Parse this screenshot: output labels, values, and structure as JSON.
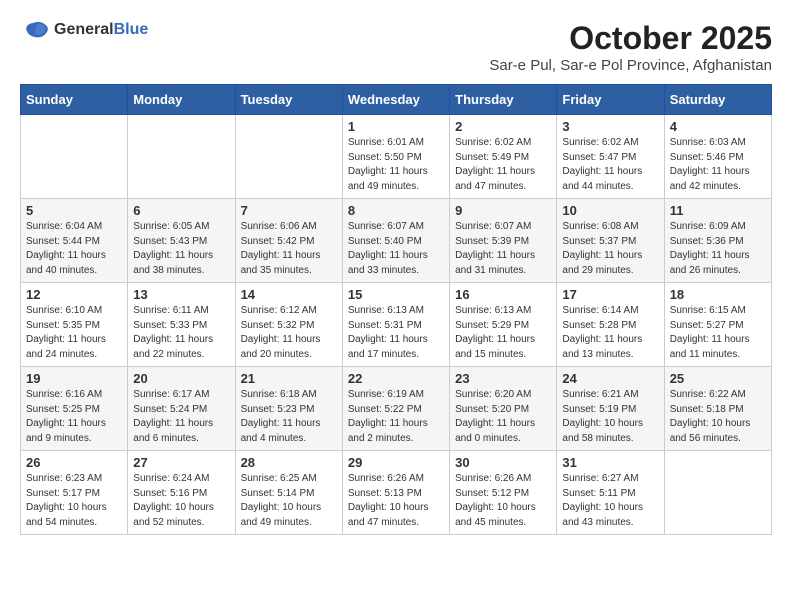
{
  "logo": {
    "general": "General",
    "blue": "Blue"
  },
  "title": "October 2025",
  "location": "Sar-e Pul, Sar-e Pol Province, Afghanistan",
  "days_of_week": [
    "Sunday",
    "Monday",
    "Tuesday",
    "Wednesday",
    "Thursday",
    "Friday",
    "Saturday"
  ],
  "weeks": [
    [
      {
        "day": "",
        "content": ""
      },
      {
        "day": "",
        "content": ""
      },
      {
        "day": "",
        "content": ""
      },
      {
        "day": "1",
        "content": "Sunrise: 6:01 AM\nSunset: 5:50 PM\nDaylight: 11 hours and 49 minutes."
      },
      {
        "day": "2",
        "content": "Sunrise: 6:02 AM\nSunset: 5:49 PM\nDaylight: 11 hours and 47 minutes."
      },
      {
        "day": "3",
        "content": "Sunrise: 6:02 AM\nSunset: 5:47 PM\nDaylight: 11 hours and 44 minutes."
      },
      {
        "day": "4",
        "content": "Sunrise: 6:03 AM\nSunset: 5:46 PM\nDaylight: 11 hours and 42 minutes."
      }
    ],
    [
      {
        "day": "5",
        "content": "Sunrise: 6:04 AM\nSunset: 5:44 PM\nDaylight: 11 hours and 40 minutes."
      },
      {
        "day": "6",
        "content": "Sunrise: 6:05 AM\nSunset: 5:43 PM\nDaylight: 11 hours and 38 minutes."
      },
      {
        "day": "7",
        "content": "Sunrise: 6:06 AM\nSunset: 5:42 PM\nDaylight: 11 hours and 35 minutes."
      },
      {
        "day": "8",
        "content": "Sunrise: 6:07 AM\nSunset: 5:40 PM\nDaylight: 11 hours and 33 minutes."
      },
      {
        "day": "9",
        "content": "Sunrise: 6:07 AM\nSunset: 5:39 PM\nDaylight: 11 hours and 31 minutes."
      },
      {
        "day": "10",
        "content": "Sunrise: 6:08 AM\nSunset: 5:37 PM\nDaylight: 11 hours and 29 minutes."
      },
      {
        "day": "11",
        "content": "Sunrise: 6:09 AM\nSunset: 5:36 PM\nDaylight: 11 hours and 26 minutes."
      }
    ],
    [
      {
        "day": "12",
        "content": "Sunrise: 6:10 AM\nSunset: 5:35 PM\nDaylight: 11 hours and 24 minutes."
      },
      {
        "day": "13",
        "content": "Sunrise: 6:11 AM\nSunset: 5:33 PM\nDaylight: 11 hours and 22 minutes."
      },
      {
        "day": "14",
        "content": "Sunrise: 6:12 AM\nSunset: 5:32 PM\nDaylight: 11 hours and 20 minutes."
      },
      {
        "day": "15",
        "content": "Sunrise: 6:13 AM\nSunset: 5:31 PM\nDaylight: 11 hours and 17 minutes."
      },
      {
        "day": "16",
        "content": "Sunrise: 6:13 AM\nSunset: 5:29 PM\nDaylight: 11 hours and 15 minutes."
      },
      {
        "day": "17",
        "content": "Sunrise: 6:14 AM\nSunset: 5:28 PM\nDaylight: 11 hours and 13 minutes."
      },
      {
        "day": "18",
        "content": "Sunrise: 6:15 AM\nSunset: 5:27 PM\nDaylight: 11 hours and 11 minutes."
      }
    ],
    [
      {
        "day": "19",
        "content": "Sunrise: 6:16 AM\nSunset: 5:25 PM\nDaylight: 11 hours and 9 minutes."
      },
      {
        "day": "20",
        "content": "Sunrise: 6:17 AM\nSunset: 5:24 PM\nDaylight: 11 hours and 6 minutes."
      },
      {
        "day": "21",
        "content": "Sunrise: 6:18 AM\nSunset: 5:23 PM\nDaylight: 11 hours and 4 minutes."
      },
      {
        "day": "22",
        "content": "Sunrise: 6:19 AM\nSunset: 5:22 PM\nDaylight: 11 hours and 2 minutes."
      },
      {
        "day": "23",
        "content": "Sunrise: 6:20 AM\nSunset: 5:20 PM\nDaylight: 11 hours and 0 minutes."
      },
      {
        "day": "24",
        "content": "Sunrise: 6:21 AM\nSunset: 5:19 PM\nDaylight: 10 hours and 58 minutes."
      },
      {
        "day": "25",
        "content": "Sunrise: 6:22 AM\nSunset: 5:18 PM\nDaylight: 10 hours and 56 minutes."
      }
    ],
    [
      {
        "day": "26",
        "content": "Sunrise: 6:23 AM\nSunset: 5:17 PM\nDaylight: 10 hours and 54 minutes."
      },
      {
        "day": "27",
        "content": "Sunrise: 6:24 AM\nSunset: 5:16 PM\nDaylight: 10 hours and 52 minutes."
      },
      {
        "day": "28",
        "content": "Sunrise: 6:25 AM\nSunset: 5:14 PM\nDaylight: 10 hours and 49 minutes."
      },
      {
        "day": "29",
        "content": "Sunrise: 6:26 AM\nSunset: 5:13 PM\nDaylight: 10 hours and 47 minutes."
      },
      {
        "day": "30",
        "content": "Sunrise: 6:26 AM\nSunset: 5:12 PM\nDaylight: 10 hours and 45 minutes."
      },
      {
        "day": "31",
        "content": "Sunrise: 6:27 AM\nSunset: 5:11 PM\nDaylight: 10 hours and 43 minutes."
      },
      {
        "day": "",
        "content": ""
      }
    ]
  ]
}
